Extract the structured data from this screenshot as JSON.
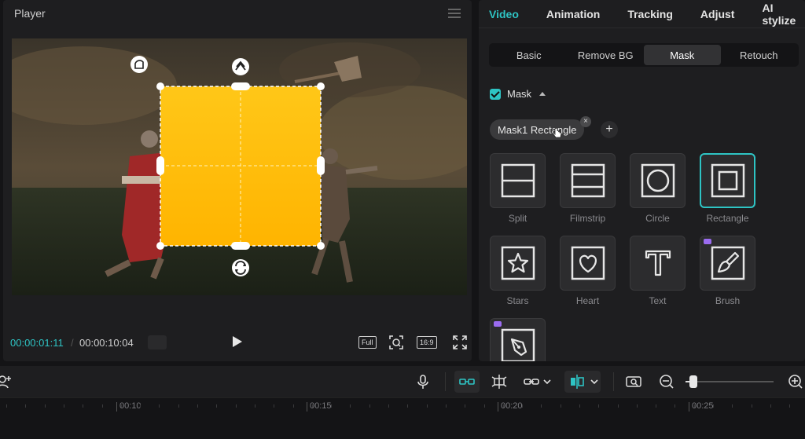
{
  "player": {
    "title": "Player",
    "current_time": "00:00:01:11",
    "separator": "/",
    "total_time": "00:00:10:04",
    "full_label": "Full",
    "ratio_label": "16:9"
  },
  "panel": {
    "tabs": [
      "Video",
      "Animation",
      "Tracking",
      "Adjust",
      "AI stylize"
    ],
    "active_tab": "Video",
    "subtabs": [
      "Basic",
      "Remove BG",
      "Mask",
      "Retouch"
    ],
    "active_subtab": "Mask",
    "mask_label": "Mask",
    "mask_pill": "Mask1 Rectangle",
    "pill_close": "×",
    "add": "+",
    "shapes": [
      {
        "label": "Split",
        "icon": "split-icon"
      },
      {
        "label": "Filmstrip",
        "icon": "filmstrip-icon"
      },
      {
        "label": "Circle",
        "icon": "circle-icon"
      },
      {
        "label": "Rectangle",
        "icon": "rectangle-icon"
      },
      {
        "label": "Stars",
        "icon": "star-icon"
      },
      {
        "label": "Heart",
        "icon": "heart-icon"
      },
      {
        "label": "Text",
        "icon": "text-icon"
      },
      {
        "label": "Brush",
        "icon": "brush-icon"
      },
      {
        "label": "",
        "icon": "pen-icon"
      }
    ],
    "selected_shape": "Rectangle"
  },
  "timeline": {
    "ticks": [
      "00:10",
      "00:15",
      "00:20",
      "00:25"
    ],
    "zoom_level": 0.05
  },
  "colors": {
    "accent": "#2ec4c4",
    "mask_fill": "#ffc000",
    "badge": "#9b6cf0"
  }
}
